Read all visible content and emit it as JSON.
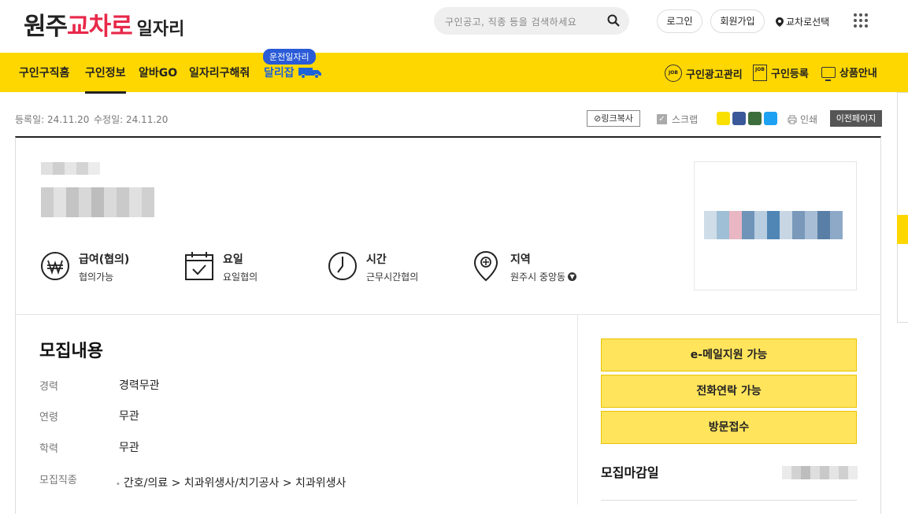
{
  "header": {
    "logo_part1": "원주",
    "logo_part2": "교차로",
    "logo_part3": "일자리",
    "search_placeholder": "구인공고, 직종 등을 검색하세요",
    "login": "로그인",
    "signup": "회원가입",
    "location": "교차로선택"
  },
  "nav": {
    "items": [
      "구인구직홈",
      "구인정보",
      "알바GO",
      "일자리구해줘",
      "달리잡"
    ],
    "badge": "운전일자리",
    "right_items": [
      "구인광고관리",
      "구인등록",
      "상품안내"
    ],
    "job_icon_text": "JOB"
  },
  "meta": {
    "registered": "등록일: 24.11.20",
    "modified": "수정일: 24.11.20",
    "link_copy": "링크복사",
    "scrap": "스크랩",
    "print": "인쇄",
    "prev_page": "이전페이지"
  },
  "summary": [
    {
      "title": "급여(협의)",
      "sub": "협의가능"
    },
    {
      "title": "요일",
      "sub": "요일협의"
    },
    {
      "title": "시간",
      "sub": "근무시간협의"
    },
    {
      "title": "지역",
      "sub": "원주시 중앙동"
    }
  ],
  "recruit": {
    "title": "모집내용",
    "rows": [
      {
        "key": "경력",
        "value": "경력무관"
      },
      {
        "key": "연령",
        "value": "무관"
      },
      {
        "key": "학력",
        "value": "무관"
      },
      {
        "key": "모집직종",
        "value": "간호/의료 > 치과위생사/치기공사 > 치과위생사"
      }
    ]
  },
  "apply_methods": [
    "e-메일지원 가능",
    "전화연락 가능",
    "방문접수"
  ],
  "deadline_label": "모집마감일",
  "colors": {
    "brand_red": "#e8294a",
    "nav_yellow": "#ffd700",
    "button_yellow": "#ffe45c",
    "active_blue": "#1d62d8"
  }
}
